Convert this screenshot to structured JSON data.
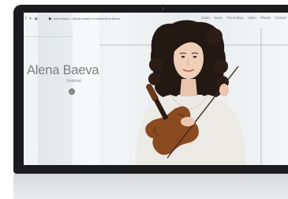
{
  "site": {
    "social": [
      "f",
      "✦",
      "◉"
    ],
    "url_text": "Alena Baeva – Official website of violinist Alena Baeva",
    "nav": [
      "Dates",
      "News",
      "Recordings",
      "Video",
      "Photos",
      "Contact"
    ]
  },
  "hero": {
    "name": "Alena Baeva",
    "subtitle": "Violinist",
    "scroll_icon": "chevron-down-icon"
  },
  "colors": {
    "frame": "#1c1c1e",
    "hair": "#241813",
    "violin": "#8b4a20",
    "blouse": "#eceae5"
  }
}
